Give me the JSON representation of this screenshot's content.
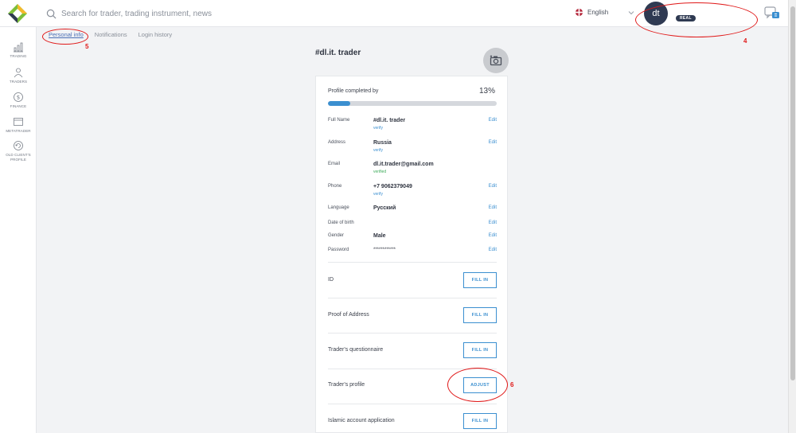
{
  "header": {
    "search_placeholder": "Search for trader, trading instrument, news",
    "language": "English",
    "avatar_initials": "dt",
    "account_badge": "REAL"
  },
  "sidebar": {
    "items": [
      {
        "label": "TRADING",
        "icon": "chart-icon"
      },
      {
        "label": "TRADERS",
        "icon": "people-icon"
      },
      {
        "label": "FINANCE",
        "icon": "coin-icon"
      },
      {
        "label": "METATRADER",
        "icon": "window-icon"
      },
      {
        "label": "OLD CLIENT'S PROFILE",
        "icon": "refresh-icon"
      }
    ]
  },
  "tabs": [
    {
      "label": "Personal info",
      "active": true
    },
    {
      "label": "Notifications",
      "active": false
    },
    {
      "label": "Login history",
      "active": false
    }
  ],
  "profile": {
    "username": "#dl.it. trader",
    "completed_label": "Profile completed by",
    "completed_percent": "13%",
    "completed_value": 0.13,
    "fields": [
      {
        "label": "Full Name",
        "value": "#dl.it. trader",
        "sub": "verify",
        "edit": "Edit"
      },
      {
        "label": "Address",
        "value": "Russia",
        "sub": "verify",
        "edit": "Edit"
      },
      {
        "label": "Email",
        "value": "dl.it.trader@gmail.com",
        "sub": "verified",
        "edit": ""
      },
      {
        "label": "Phone",
        "value": "+7 9062379049",
        "sub": "verify",
        "edit": "Edit"
      },
      {
        "label": "Language",
        "value": "Русский",
        "sub": "",
        "edit": "Edit"
      },
      {
        "label": "Date of birth",
        "value": "",
        "sub": "",
        "edit": "Edit"
      },
      {
        "label": "Gender",
        "value": "Male",
        "sub": "",
        "edit": "Edit"
      },
      {
        "label": "Password",
        "value": "************",
        "sub": "",
        "edit": "Edit"
      }
    ],
    "documents": [
      {
        "label": "ID",
        "button": "FILL IN"
      },
      {
        "label": "Proof of Address",
        "button": "FILL IN"
      },
      {
        "label": "Trader's questionnaire",
        "button": "FILL IN"
      },
      {
        "label": "Trader's profile",
        "button": "ADJUST"
      },
      {
        "label": "Islamic account application",
        "button": "FILL IN"
      }
    ]
  },
  "annotations": {
    "a4": "4",
    "a5": "5",
    "a6": "6"
  },
  "colors": {
    "accent": "#3b8fd0",
    "annotation": "#e01818",
    "avatar": "#2f3a52",
    "verified": "#3dab5a"
  }
}
